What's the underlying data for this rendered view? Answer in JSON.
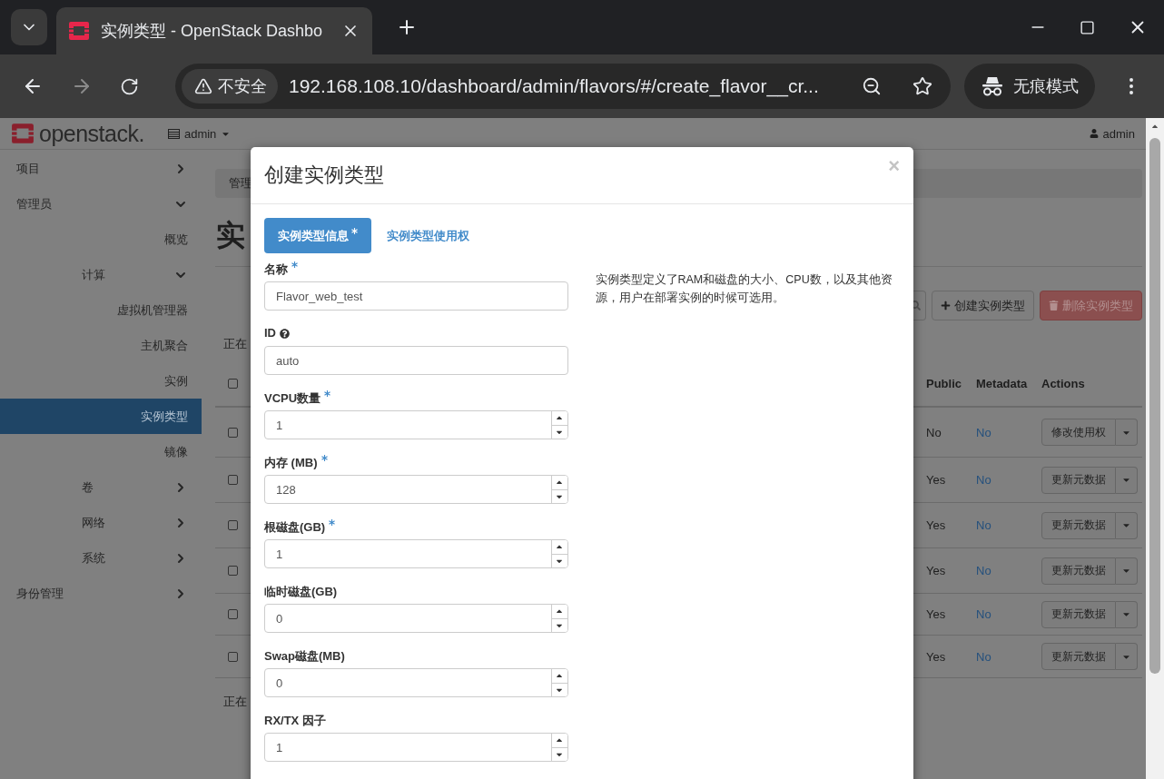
{
  "browser": {
    "tab": {
      "title": "实例类型 - OpenStack Dashbo"
    },
    "address_bar": {
      "security": "不安全",
      "url": "192.168.108.10/dashboard/admin/flavors/#/create_flavor__cr..."
    },
    "profile": {
      "label": "无痕模式"
    }
  },
  "header": {
    "logo": "openstack.",
    "project_menu": "admin",
    "user_menu": "admin"
  },
  "sidebar": {
    "items": [
      {
        "label": "项目",
        "kind": "group",
        "expanded": false
      },
      {
        "label": "管理员",
        "kind": "group",
        "expanded": true,
        "children": [
          {
            "label": "概览",
            "kind": "link",
            "selected": false
          },
          {
            "label": "计算",
            "kind": "group",
            "expanded": true,
            "children": [
              {
                "label": "虚拟机管理器",
                "kind": "link",
                "selected": false
              },
              {
                "label": "主机聚合",
                "kind": "link",
                "selected": false
              },
              {
                "label": "实例",
                "kind": "link",
                "selected": false
              },
              {
                "label": "实例类型",
                "kind": "link",
                "selected": true
              },
              {
                "label": "镜像",
                "kind": "link",
                "selected": false
              }
            ]
          },
          {
            "label": "卷",
            "kind": "group",
            "expanded": false
          },
          {
            "label": "网络",
            "kind": "group",
            "expanded": false
          },
          {
            "label": "系统",
            "kind": "group",
            "expanded": false
          }
        ]
      },
      {
        "label": "身份管理",
        "kind": "group",
        "expanded": false
      }
    ]
  },
  "content": {
    "breadcrumb": "管理",
    "title": "实",
    "toolbar": {
      "buttons": [
        {
          "kind": "create",
          "label": "创建实例类型"
        },
        {
          "kind": "delete",
          "label": "删除实例类型",
          "disabled": true
        }
      ]
    },
    "summary_top": "正在",
    "table": {
      "header_checked": false,
      "columns": [
        "Public",
        "Metadata",
        "Actions"
      ],
      "rows": [
        {
          "checked": false,
          "public": "No",
          "metadata": "No",
          "action": "修改使用权"
        },
        {
          "checked": false,
          "public": "Yes",
          "metadata": "No",
          "action": "更新元数据"
        },
        {
          "checked": false,
          "public": "Yes",
          "metadata": "No",
          "action": "更新元数据"
        },
        {
          "checked": false,
          "public": "Yes",
          "metadata": "No",
          "action": "更新元数据"
        },
        {
          "checked": false,
          "public": "Yes",
          "metadata": "No",
          "action": "更新元数据"
        },
        {
          "checked": false,
          "public": "Yes",
          "metadata": "No",
          "action": "更新元数据"
        }
      ]
    },
    "summary_bottom": "正在"
  },
  "modal": {
    "title": "创建实例类型",
    "close": "×",
    "tabs": [
      {
        "label": "实例类型信息",
        "required": true,
        "selected": true
      },
      {
        "label": "实例类型使用权",
        "required": false,
        "selected": false
      }
    ],
    "fields": [
      {
        "kind": "text",
        "label": "名称",
        "required": true,
        "value": "Flavor_web_test"
      },
      {
        "kind": "text",
        "label": "ID",
        "help": true,
        "value": "auto"
      },
      {
        "kind": "number",
        "label": "VCPU数量",
        "required": true,
        "value": "1"
      },
      {
        "kind": "number",
        "label": "内存 (MB)",
        "required": true,
        "value": "128"
      },
      {
        "kind": "number",
        "label": "根磁盘(GB)",
        "required": true,
        "value": "1"
      },
      {
        "kind": "number",
        "label": "临时磁盘(GB)",
        "value": "0"
      },
      {
        "kind": "number",
        "label": "Swap磁盘(MB)",
        "value": "0"
      },
      {
        "kind": "number",
        "label": "RX/TX 因子",
        "value": "1"
      }
    ],
    "description": "实例类型定义了RAM和磁盘的大小、CPU数，以及其他资源，用户在部署实例的时候可选用。"
  }
}
